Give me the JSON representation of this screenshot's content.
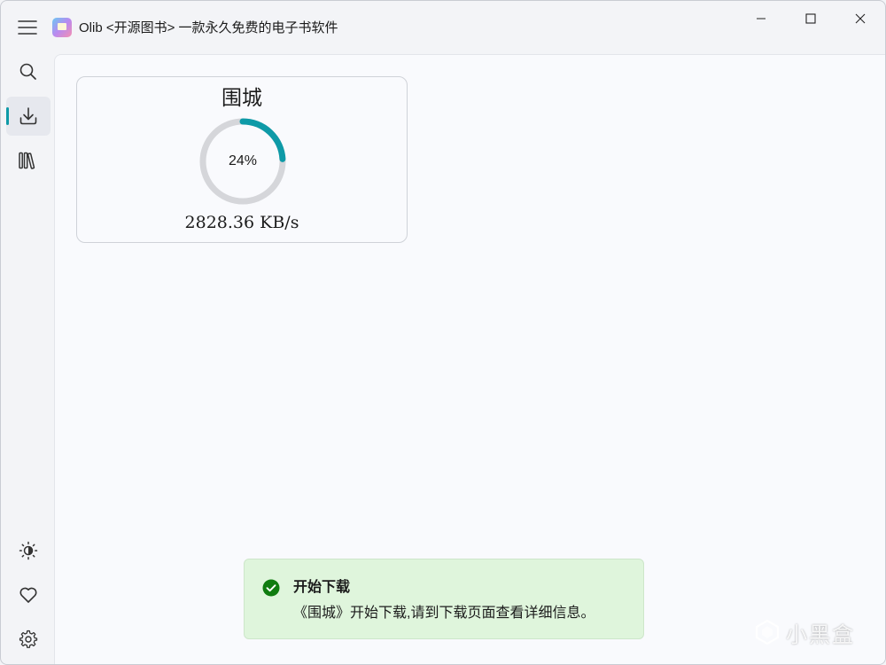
{
  "window": {
    "title": "Olib <开源图书> 一款永久免费的电子书软件",
    "controls": [
      "minimize",
      "maximize",
      "close"
    ]
  },
  "sidebar": {
    "top_items": [
      {
        "name": "search",
        "icon": "search-icon",
        "active": false
      },
      {
        "name": "downloads",
        "icon": "download-icon",
        "active": true
      },
      {
        "name": "library",
        "icon": "library-icon",
        "active": false
      }
    ],
    "bottom_items": [
      {
        "name": "theme",
        "icon": "theme-brightness-icon"
      },
      {
        "name": "favorites",
        "icon": "heart-icon"
      },
      {
        "name": "settings",
        "icon": "gear-icon"
      }
    ]
  },
  "download": {
    "book_title": "围城",
    "progress_label": "24%",
    "progress_fraction": 0.24,
    "speed": "2828.36 KB/s"
  },
  "toast": {
    "status": "success",
    "title": "开始下载",
    "message": "《围城》开始下载,请到下载页面查看详细信息。"
  },
  "watermark": {
    "text": "小黑盒"
  },
  "colors": {
    "accent": "#0e9aa7",
    "progress_track": "#d5d6da",
    "toast_background": "#dff5dc",
    "toast_icon": "#107c10"
  }
}
